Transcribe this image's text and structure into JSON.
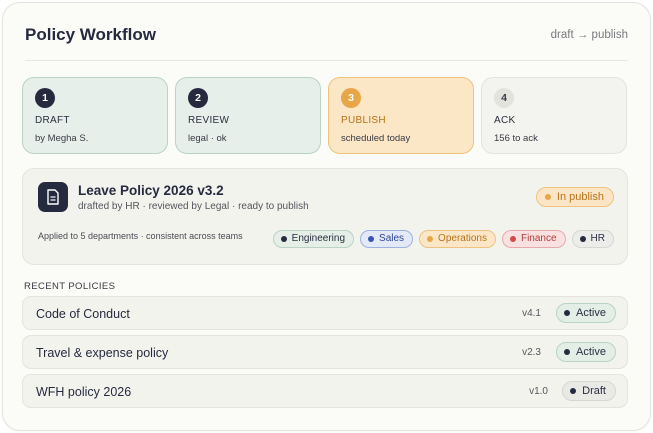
{
  "header": {
    "title": "Policy Workflow",
    "flow": "draft → publish"
  },
  "steps": [
    {
      "num": "1",
      "label": "DRAFT",
      "sub": "by Megha S.",
      "state": "done"
    },
    {
      "num": "2",
      "label": "REVIEW",
      "sub": "legal · ok",
      "state": "done"
    },
    {
      "num": "3",
      "label": "PUBLISH",
      "sub": "scheduled today",
      "state": "active"
    },
    {
      "num": "4",
      "label": "ACK",
      "sub": "156 to ack",
      "state": "todo"
    }
  ],
  "policy": {
    "icon": "document-icon",
    "name": "Leave Policy 2026 v3.2",
    "meta": "drafted by HR · reviewed by Legal · ready to publish",
    "status": "In publish",
    "applied": "Applied to 5 departments · consistent across teams",
    "departments": [
      "Engineering",
      "Sales",
      "Operations",
      "Finance",
      "HR"
    ]
  },
  "recent": {
    "heading": "RECENT POLICIES",
    "items": [
      {
        "name": "Code of Conduct",
        "version": "v4.1",
        "status": "Active"
      },
      {
        "name": "Travel & expense policy",
        "version": "v2.3",
        "status": "Active"
      },
      {
        "name": "WFH policy 2026",
        "version": "v1.0",
        "status": "Draft"
      }
    ]
  },
  "colors": {
    "accent": "#262a3f",
    "publish": "#e7a647",
    "done_bg": "#e7efea",
    "active_bg": "#fbe6c6"
  }
}
